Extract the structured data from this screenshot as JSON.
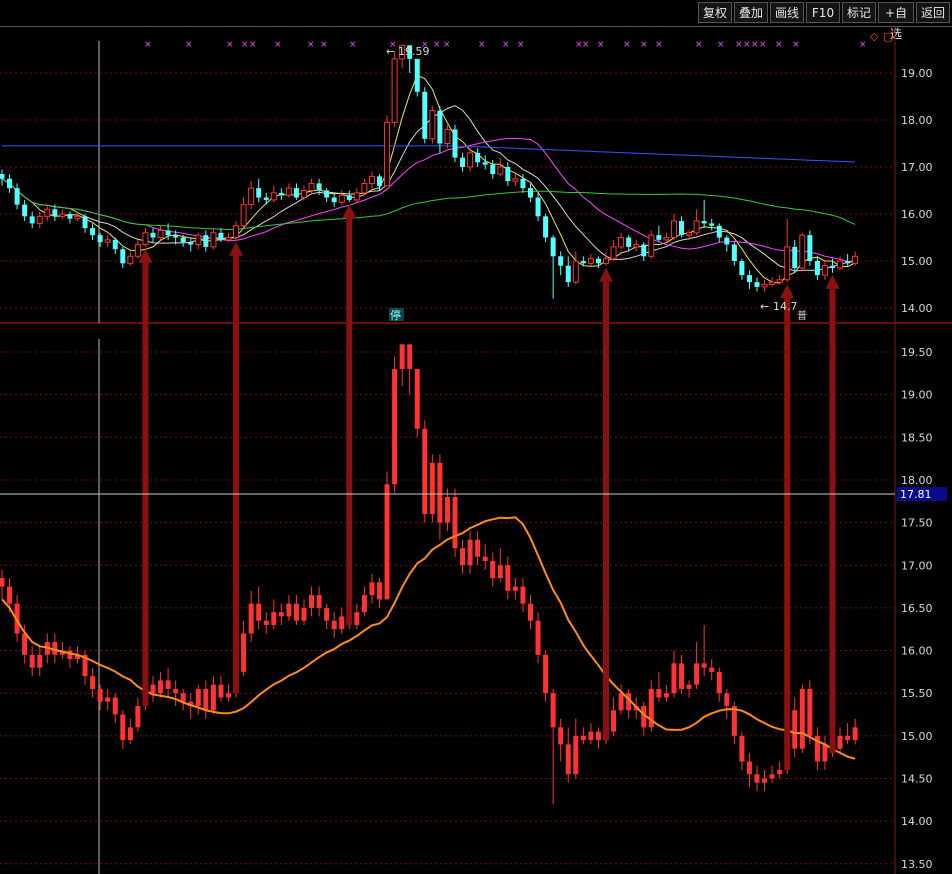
{
  "toolbar": {
    "buttons": [
      "复权",
      "叠加",
      "画线",
      "F10",
      "标记",
      "+自选",
      "返回"
    ]
  },
  "top_icons": {
    "diamond": "◇",
    "square": "▢"
  },
  "price_panel": {
    "y_ticks": [
      "19.00",
      "18.00",
      "17.00",
      "16.00",
      "15.00",
      "14.00"
    ],
    "high_label": "19.59",
    "low_label": "14.7",
    "stop_badge": "停",
    "event_badge": "普"
  },
  "lower_panel": {
    "y_ticks": [
      "19.50",
      "19.00",
      "18.50",
      "18.00",
      "17.50",
      "17.00",
      "16.50",
      "16.00",
      "15.50",
      "15.00",
      "14.50",
      "14.00",
      "13.50"
    ],
    "crosshair_value": "17.81"
  },
  "colors": {
    "up_candle": "#ff3333",
    "down_candle": "#54ffff",
    "ma_white": "#d8d8d8",
    "ma_yellow": "#e8e85a",
    "ma_magenta": "#ff44ff",
    "ma_green": "#33cc33",
    "ma_blue": "#3355ff",
    "cost_line": "#ff8c1a",
    "arrow": "#8b1010",
    "marker_x": "#ff44ff",
    "grid": "#7a0d0d",
    "crosshair_box": "#0a0a8a"
  },
  "chart_data": {
    "type": "candlestick",
    "x_marker_count": 30,
    "candles": [
      [
        16.85,
        16.75,
        16.95,
        16.6
      ],
      [
        16.75,
        16.55,
        16.85,
        16.45
      ],
      [
        16.55,
        16.2,
        16.65,
        16.1
      ],
      [
        16.2,
        15.95,
        16.3,
        15.85
      ],
      [
        15.95,
        15.8,
        16.05,
        15.7
      ],
      [
        15.8,
        15.95,
        16.05,
        15.7
      ],
      [
        15.95,
        16.1,
        16.2,
        15.85
      ],
      [
        16.1,
        15.95,
        16.2,
        15.85
      ],
      [
        15.95,
        16.0,
        16.1,
        15.9
      ],
      [
        16.0,
        15.9,
        16.05,
        15.8
      ],
      [
        15.9,
        15.95,
        16.05,
        15.85
      ],
      [
        15.95,
        15.7,
        16.0,
        15.6
      ],
      [
        15.7,
        15.55,
        15.8,
        15.45
      ],
      [
        15.55,
        15.4,
        15.6,
        15.3
      ],
      [
        15.4,
        15.45,
        15.55,
        15.3
      ],
      [
        15.45,
        15.25,
        15.5,
        15.15
      ],
      [
        15.25,
        14.95,
        15.3,
        14.85
      ],
      [
        14.95,
        15.1,
        15.2,
        14.9
      ],
      [
        15.1,
        15.35,
        15.45,
        15.05
      ],
      [
        15.35,
        15.6,
        15.7,
        15.3
      ],
      [
        15.6,
        15.5,
        15.7,
        15.4
      ],
      [
        15.5,
        15.65,
        15.75,
        15.45
      ],
      [
        15.65,
        15.55,
        15.8,
        15.45
      ],
      [
        15.55,
        15.5,
        15.65,
        15.35
      ],
      [
        15.5,
        15.4,
        15.55,
        15.3
      ],
      [
        15.4,
        15.35,
        15.5,
        15.2
      ],
      [
        15.35,
        15.55,
        15.6,
        15.25
      ],
      [
        15.55,
        15.3,
        15.65,
        15.2
      ],
      [
        15.3,
        15.6,
        15.7,
        15.25
      ],
      [
        15.6,
        15.45,
        15.7,
        15.4
      ],
      [
        15.45,
        15.5,
        15.6,
        15.4
      ],
      [
        15.5,
        15.75,
        15.85,
        15.45
      ],
      [
        15.75,
        16.2,
        16.35,
        15.7
      ],
      [
        16.2,
        16.55,
        16.7,
        16.1
      ],
      [
        16.55,
        16.35,
        16.75,
        16.25
      ],
      [
        16.35,
        16.3,
        16.45,
        16.2
      ],
      [
        16.3,
        16.45,
        16.6,
        16.25
      ],
      [
        16.45,
        16.4,
        16.55,
        16.3
      ],
      [
        16.4,
        16.55,
        16.65,
        16.35
      ],
      [
        16.55,
        16.35,
        16.65,
        16.3
      ],
      [
        16.35,
        16.5,
        16.6,
        16.3
      ],
      [
        16.5,
        16.65,
        16.75,
        16.4
      ],
      [
        16.65,
        16.5,
        16.75,
        16.4
      ],
      [
        16.5,
        16.35,
        16.55,
        16.25
      ],
      [
        16.35,
        16.25,
        16.45,
        16.15
      ],
      [
        16.25,
        16.4,
        16.5,
        16.2
      ],
      [
        16.4,
        16.3,
        16.5,
        16.25
      ],
      [
        16.3,
        16.45,
        16.55,
        16.25
      ],
      [
        16.45,
        16.65,
        16.75,
        16.4
      ],
      [
        16.65,
        16.8,
        16.9,
        16.55
      ],
      [
        16.8,
        16.6,
        16.85,
        16.5
      ],
      [
        16.6,
        17.95,
        18.1,
        16.6
      ],
      [
        17.95,
        19.3,
        19.45,
        17.85
      ],
      [
        19.3,
        19.59,
        19.59,
        19.1
      ],
      [
        19.59,
        19.3,
        19.59,
        19.0
      ],
      [
        19.3,
        18.6,
        19.3,
        18.5
      ],
      [
        18.6,
        17.6,
        18.7,
        17.5
      ],
      [
        17.6,
        18.2,
        18.3,
        17.5
      ],
      [
        18.2,
        17.5,
        18.3,
        17.3
      ],
      [
        17.5,
        17.8,
        17.9,
        17.4
      ],
      [
        17.8,
        17.2,
        17.9,
        17.1
      ],
      [
        17.2,
        17.0,
        17.3,
        16.9
      ],
      [
        17.0,
        17.3,
        17.4,
        16.9
      ],
      [
        17.3,
        17.1,
        17.4,
        17.0
      ],
      [
        17.1,
        17.05,
        17.25,
        16.95
      ],
      [
        17.05,
        16.85,
        17.15,
        16.75
      ],
      [
        16.85,
        17.0,
        17.2,
        16.8
      ],
      [
        17.0,
        16.7,
        17.1,
        16.6
      ],
      [
        16.7,
        16.75,
        16.85,
        16.6
      ],
      [
        16.75,
        16.55,
        16.85,
        16.45
      ],
      [
        16.55,
        16.35,
        16.65,
        16.25
      ],
      [
        16.35,
        15.95,
        16.45,
        15.85
      ],
      [
        15.95,
        15.5,
        16.0,
        15.4
      ],
      [
        15.5,
        15.1,
        15.55,
        14.2
      ],
      [
        15.1,
        14.9,
        15.2,
        14.7
      ],
      [
        14.9,
        14.55,
        15.1,
        14.45
      ],
      [
        14.55,
        15.0,
        15.2,
        14.5
      ],
      [
        15.0,
        14.95,
        15.1,
        14.9
      ],
      [
        14.95,
        15.05,
        15.15,
        14.9
      ],
      [
        15.05,
        14.95,
        15.1,
        14.85
      ],
      [
        14.95,
        15.05,
        15.2,
        14.9
      ],
      [
        15.05,
        15.3,
        15.45,
        15.0
      ],
      [
        15.3,
        15.5,
        15.6,
        15.25
      ],
      [
        15.5,
        15.3,
        15.55,
        15.2
      ],
      [
        15.3,
        15.35,
        15.45,
        15.2
      ],
      [
        15.35,
        15.1,
        15.4,
        15.0
      ],
      [
        15.1,
        15.55,
        15.65,
        15.05
      ],
      [
        15.55,
        15.45,
        15.75,
        15.4
      ],
      [
        15.45,
        15.5,
        15.6,
        15.4
      ],
      [
        15.5,
        15.85,
        16.0,
        15.45
      ],
      [
        15.85,
        15.55,
        15.95,
        15.5
      ],
      [
        15.55,
        15.6,
        15.65,
        15.45
      ],
      [
        15.6,
        15.85,
        16.1,
        15.55
      ],
      [
        15.85,
        15.8,
        16.3,
        15.7
      ],
      [
        15.8,
        15.75,
        15.9,
        15.65
      ],
      [
        15.75,
        15.5,
        15.8,
        15.4
      ],
      [
        15.5,
        15.35,
        15.55,
        15.2
      ],
      [
        15.35,
        15.0,
        15.4,
        14.9
      ],
      [
        15.0,
        14.7,
        15.05,
        14.6
      ],
      [
        14.7,
        14.55,
        14.8,
        14.4
      ],
      [
        14.55,
        14.45,
        14.65,
        14.35
      ],
      [
        14.45,
        14.5,
        14.6,
        14.35
      ],
      [
        14.5,
        14.55,
        14.65,
        14.45
      ],
      [
        14.55,
        14.6,
        14.7,
        14.5
      ],
      [
        14.6,
        15.3,
        15.9,
        14.55
      ],
      [
        15.3,
        14.85,
        15.45,
        14.75
      ],
      [
        14.85,
        15.55,
        15.6,
        14.8
      ],
      [
        15.55,
        15.0,
        15.65,
        14.9
      ],
      [
        15.0,
        14.7,
        15.1,
        14.6
      ],
      [
        14.7,
        14.9,
        15.0,
        14.6
      ],
      [
        14.9,
        14.85,
        15.05,
        14.75
      ],
      [
        14.85,
        15.0,
        15.1,
        14.8
      ],
      [
        15.0,
        14.95,
        15.15,
        14.9
      ],
      [
        14.95,
        15.1,
        15.2,
        14.9
      ]
    ]
  }
}
